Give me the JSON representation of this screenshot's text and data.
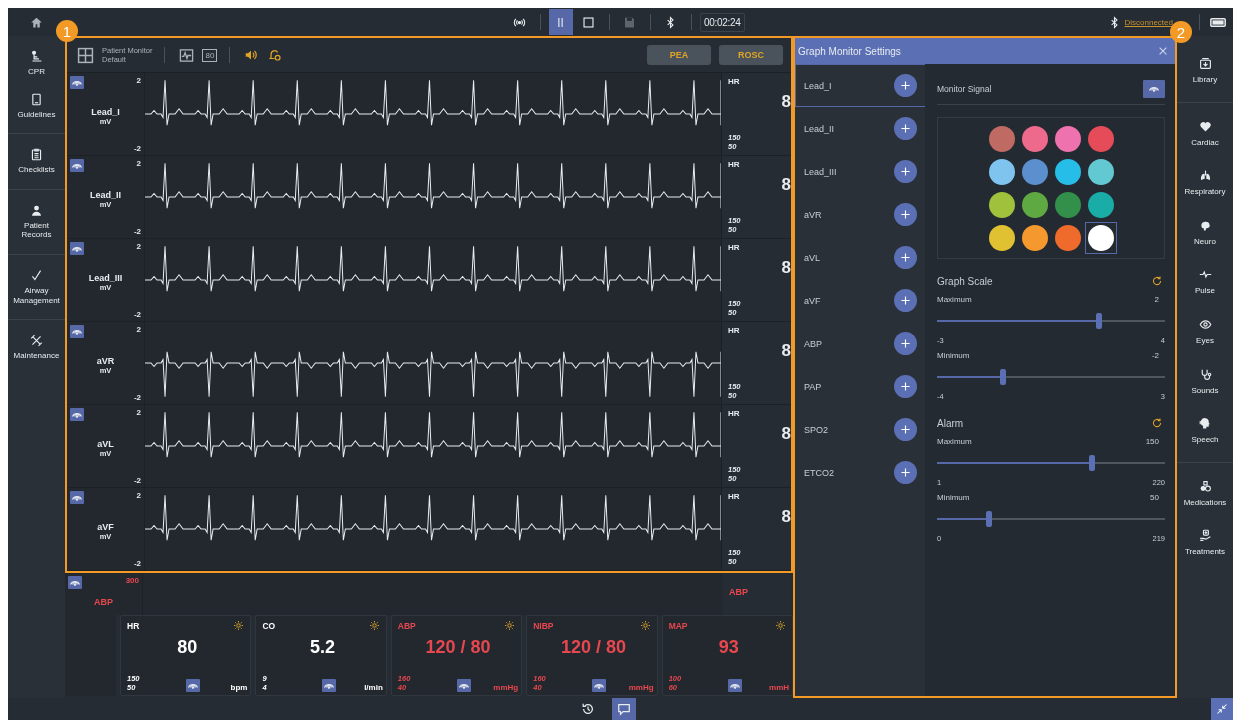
{
  "top_bar": {
    "controls": [
      [
        {
          "kind": "signal",
          "selected": false,
          "disabled": false
        }
      ],
      [
        {
          "kind": "pause",
          "selected": true,
          "disabled": false
        },
        {
          "kind": "stop",
          "selected": false,
          "disabled": false
        }
      ],
      [
        {
          "kind": "save",
          "selected": false,
          "disabled": true
        }
      ],
      [
        {
          "kind": "bluetooth",
          "selected": false,
          "disabled": false
        }
      ]
    ],
    "timer": "00:02:24",
    "connection": "Disconnected"
  },
  "left_nav": {
    "groups": [
      {
        "items": [
          {
            "kind": "cpr",
            "label": "CPR"
          },
          {
            "kind": "guidelines",
            "label": "Guidelines"
          }
        ]
      },
      {
        "items": [
          {
            "kind": "checklists",
            "label": "Checklists"
          }
        ]
      },
      {
        "items": [
          {
            "kind": "patient",
            "label": "Patient Records"
          }
        ]
      },
      {
        "items": [
          {
            "kind": "airway",
            "label": "Airway Management"
          }
        ]
      },
      {
        "items": [
          {
            "kind": "maintenance",
            "label": "Maintenance"
          }
        ]
      }
    ]
  },
  "monitor": {
    "profile_title": "Patient Monitor",
    "profile_name": "Default",
    "numeric_tool": "80",
    "events": [
      {
        "label": "PEA"
      },
      {
        "label": "ROSC"
      }
    ],
    "leads": [
      {
        "name": "Lead_I",
        "unit": "mV",
        "scale_max": "2",
        "scale_min": "-2",
        "inverted": false,
        "hr": {
          "label": "HR",
          "value": "8",
          "high": "150",
          "low": "50"
        }
      },
      {
        "name": "Lead_II",
        "unit": "mV",
        "scale_max": "2",
        "scale_min": "-2",
        "inverted": false,
        "hr": {
          "label": "HR",
          "value": "8",
          "high": "150",
          "low": "50"
        }
      },
      {
        "name": "Lead_III",
        "unit": "mV",
        "scale_max": "2",
        "scale_min": "-2",
        "inverted": false,
        "hr": {
          "label": "HR",
          "value": "8",
          "high": "150",
          "low": "50"
        }
      },
      {
        "name": "aVR",
        "unit": "mV",
        "scale_max": "2",
        "scale_min": "-2",
        "inverted": true,
        "hr": {
          "label": "HR",
          "value": "8",
          "high": "150",
          "low": "50"
        }
      },
      {
        "name": "aVL",
        "unit": "mV",
        "scale_max": "2",
        "scale_min": "-2",
        "inverted": false,
        "hr": {
          "label": "HR",
          "value": "8",
          "high": "150",
          "low": "50"
        }
      },
      {
        "name": "aVF",
        "unit": "mV",
        "scale_max": "2",
        "scale_min": "-2",
        "inverted": false,
        "hr": {
          "label": "HR",
          "value": "8",
          "high": "150",
          "low": "50"
        }
      }
    ],
    "partial_row": {
      "scale_max": "300",
      "name": "ABP",
      "side_label": "ABP"
    },
    "tiles": [
      {
        "label": "HR",
        "value": "80",
        "high": "150",
        "low": "50",
        "unit": "bpm",
        "color": "#ffffff"
      },
      {
        "label": "CO",
        "value": "5.2",
        "high": "9",
        "low": "4",
        "unit": "l/min",
        "color": "#ffffff"
      },
      {
        "label": "ABP",
        "value": "120 / 80",
        "high": "160",
        "low": "40",
        "unit": "mmHg",
        "color": "#e8474f"
      },
      {
        "label": "NIBP",
        "value": "120 / 80",
        "high": "160",
        "low": "40",
        "unit": "mmHg",
        "color": "#e8474f"
      },
      {
        "label": "MAP",
        "value": "93",
        "high": "100",
        "low": "60",
        "unit": "mmH",
        "color": "#e8474f"
      }
    ]
  },
  "dialog": {
    "title": "Graph Monitor Settings",
    "signals": [
      {
        "name": "Lead_I",
        "selected": true
      },
      {
        "name": "Lead_II",
        "selected": false
      },
      {
        "name": "Lead_III",
        "selected": false
      },
      {
        "name": "aVR",
        "selected": false
      },
      {
        "name": "aVL",
        "selected": false
      },
      {
        "name": "aVF",
        "selected": false
      },
      {
        "name": "ABP",
        "selected": false
      },
      {
        "name": "PAP",
        "selected": false
      },
      {
        "name": "SPO2",
        "selected": false
      },
      {
        "name": "ETCO2",
        "selected": false
      }
    ],
    "monitor_signal": "Monitor Signal",
    "colors": [
      {
        "color": "#bf6b64",
        "selected": false
      },
      {
        "color": "#ee6a8c",
        "selected": false
      },
      {
        "color": "#ee72ae",
        "selected": false
      },
      {
        "color": "#e54b58",
        "selected": false
      },
      {
        "color": "#7ec4ee",
        "selected": false
      },
      {
        "color": "#5b8fce",
        "selected": false
      },
      {
        "color": "#27bde9",
        "selected": false
      },
      {
        "color": "#62c9d3",
        "selected": false
      },
      {
        "color": "#a0c13c",
        "selected": false
      },
      {
        "color": "#5fa943",
        "selected": false
      },
      {
        "color": "#33904a",
        "selected": false
      },
      {
        "color": "#1aaca6",
        "selected": false
      },
      {
        "color": "#e0c132",
        "selected": false
      },
      {
        "color": "#f5992e",
        "selected": false
      },
      {
        "color": "#ef6b2c",
        "selected": false
      },
      {
        "color": "#ffffff",
        "selected": true
      }
    ],
    "sections": [
      {
        "title": "Graph Scale",
        "sliders": [
          {
            "label": "Maximum",
            "value": "2",
            "min": "-3",
            "max": "4",
            "level": 0.71
          },
          {
            "label": "Minimum",
            "value": "-2",
            "min": "-4",
            "max": "3",
            "level": 0.29
          }
        ]
      },
      {
        "title": "Alarm",
        "sliders": [
          {
            "label": "Maximum",
            "value": "150",
            "min": "1",
            "max": "220",
            "level": 0.68
          },
          {
            "label": "Minimum",
            "value": "50",
            "min": "0",
            "max": "219",
            "level": 0.23
          }
        ]
      }
    ]
  },
  "right_nav": {
    "groups": [
      {
        "items": [
          {
            "kind": "library",
            "label": "Library"
          }
        ]
      },
      {
        "items": [
          {
            "kind": "cardiac",
            "label": "Cardiac"
          },
          {
            "kind": "respiratory",
            "label": "Respiratory"
          },
          {
            "kind": "neuro",
            "label": "Neuro"
          },
          {
            "kind": "pulse",
            "label": "Pulse"
          },
          {
            "kind": "eyes",
            "label": "Eyes"
          },
          {
            "kind": "sounds",
            "label": "Sounds"
          },
          {
            "kind": "speech",
            "label": "Speech"
          }
        ]
      },
      {
        "items": [
          {
            "kind": "medications",
            "label": "Medications"
          },
          {
            "kind": "treatments",
            "label": "Treatments"
          }
        ]
      }
    ]
  },
  "bottom_bar": {
    "buttons": [
      {
        "kind": "history",
        "selected": false
      },
      {
        "kind": "chat",
        "selected": true
      }
    ]
  },
  "annotations": [
    {
      "label": "1"
    },
    {
      "label": "2"
    }
  ]
}
